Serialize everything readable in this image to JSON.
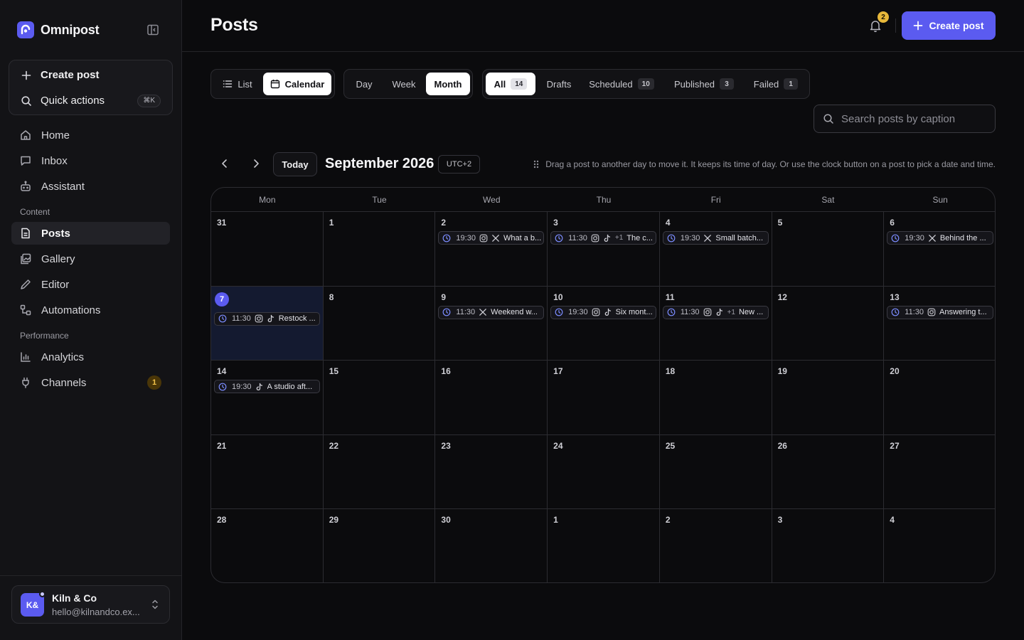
{
  "app": {
    "name": "Omnipost"
  },
  "sidebar": {
    "create_label": "Create post",
    "quick_label": "Quick actions",
    "quick_kbd": "⌘K",
    "main_items": [
      {
        "label": "Home",
        "icon": "home-icon"
      },
      {
        "label": "Inbox",
        "icon": "inbox-icon"
      },
      {
        "label": "Assistant",
        "icon": "bot-icon"
      }
    ],
    "content_label": "Content",
    "content_items": [
      {
        "label": "Posts",
        "icon": "file-icon",
        "active": true
      },
      {
        "label": "Gallery",
        "icon": "gallery-icon"
      },
      {
        "label": "Editor",
        "icon": "pen-icon"
      },
      {
        "label": "Automations",
        "icon": "workflow-icon"
      }
    ],
    "performance_label": "Performance",
    "performance_items": [
      {
        "label": "Analytics",
        "icon": "bar-chart-icon"
      },
      {
        "label": "Channels",
        "icon": "plug-icon",
        "badge": "1"
      }
    ],
    "account": {
      "initials": "K&",
      "name": "Kiln & Co",
      "email": "hello@kilnandco.ex..."
    }
  },
  "header": {
    "title": "Posts",
    "notifications_count": "2",
    "create_label": "Create post"
  },
  "toolbar": {
    "views": [
      {
        "label": "List",
        "active": false
      },
      {
        "label": "Calendar",
        "active": true
      }
    ],
    "ranges": [
      {
        "label": "Day",
        "active": false
      },
      {
        "label": "Week",
        "active": false
      },
      {
        "label": "Month",
        "active": true
      }
    ],
    "filters": [
      {
        "label": "All",
        "count": "14",
        "active": true
      },
      {
        "label": "Drafts",
        "count": "",
        "active": false
      },
      {
        "label": "Scheduled",
        "count": "10",
        "active": false
      },
      {
        "label": "Published",
        "count": "3",
        "active": false
      },
      {
        "label": "Failed",
        "count": "1",
        "active": false
      }
    ],
    "search_placeholder": "Search posts by caption"
  },
  "calendar": {
    "today_label": "Today",
    "month_label": "September 2026",
    "timezone": "UTC+2",
    "hint": "Drag a post to another day to move it. It keeps its time of day. Or use the clock button on a post to pick a date and time.",
    "weekdays": [
      "Mon",
      "Tue",
      "Wed",
      "Thu",
      "Fri",
      "Sat",
      "Sun"
    ],
    "weeks": [
      [
        {
          "day": "31",
          "posts": []
        },
        {
          "day": "1",
          "posts": []
        },
        {
          "day": "2",
          "posts": [
            {
              "time": "19:30",
              "channels": [
                "instagram",
                "x"
              ],
              "extra": "",
              "caption": "What a b..."
            }
          ]
        },
        {
          "day": "3",
          "posts": [
            {
              "time": "11:30",
              "channels": [
                "instagram",
                "tiktok"
              ],
              "extra": "+1",
              "caption": "The c..."
            }
          ]
        },
        {
          "day": "4",
          "posts": [
            {
              "time": "19:30",
              "channels": [
                "x"
              ],
              "extra": "",
              "caption": "Small batch..."
            }
          ]
        },
        {
          "day": "5",
          "posts": []
        },
        {
          "day": "6",
          "posts": [
            {
              "time": "19:30",
              "channels": [
                "x"
              ],
              "extra": "",
              "caption": "Behind the ..."
            }
          ]
        }
      ],
      [
        {
          "day": "7",
          "today": true,
          "posts": [
            {
              "time": "11:30",
              "channels": [
                "instagram",
                "tiktok"
              ],
              "extra": "",
              "caption": "Restock ..."
            }
          ]
        },
        {
          "day": "8",
          "posts": []
        },
        {
          "day": "9",
          "posts": [
            {
              "time": "11:30",
              "channels": [
                "x"
              ],
              "extra": "",
              "caption": "Weekend w..."
            }
          ]
        },
        {
          "day": "10",
          "posts": [
            {
              "time": "19:30",
              "channels": [
                "instagram",
                "tiktok"
              ],
              "extra": "",
              "caption": "Six mont..."
            }
          ]
        },
        {
          "day": "11",
          "posts": [
            {
              "time": "11:30",
              "channels": [
                "instagram",
                "tiktok"
              ],
              "extra": "+1",
              "caption": "New ..."
            }
          ]
        },
        {
          "day": "12",
          "posts": []
        },
        {
          "day": "13",
          "posts": [
            {
              "time": "11:30",
              "channels": [
                "instagram"
              ],
              "extra": "",
              "caption": "Answering t..."
            }
          ]
        }
      ],
      [
        {
          "day": "14",
          "posts": [
            {
              "time": "19:30",
              "channels": [
                "tiktok"
              ],
              "extra": "",
              "caption": "A studio aft..."
            }
          ]
        },
        {
          "day": "15",
          "posts": []
        },
        {
          "day": "16",
          "posts": []
        },
        {
          "day": "17",
          "posts": []
        },
        {
          "day": "18",
          "posts": []
        },
        {
          "day": "19",
          "posts": []
        },
        {
          "day": "20",
          "posts": []
        }
      ],
      [
        {
          "day": "21",
          "posts": []
        },
        {
          "day": "22",
          "posts": []
        },
        {
          "day": "23",
          "posts": []
        },
        {
          "day": "24",
          "posts": []
        },
        {
          "day": "25",
          "posts": []
        },
        {
          "day": "26",
          "posts": []
        },
        {
          "day": "27",
          "posts": []
        }
      ],
      [
        {
          "day": "28",
          "posts": []
        },
        {
          "day": "29",
          "posts": []
        },
        {
          "day": "30",
          "posts": []
        },
        {
          "day": "1",
          "posts": []
        },
        {
          "day": "2",
          "posts": []
        },
        {
          "day": "3",
          "posts": []
        },
        {
          "day": "4",
          "posts": []
        }
      ]
    ]
  },
  "colors": {
    "accent": "#5b5bf0",
    "background": "#0b0b0d",
    "sidebar": "#131316",
    "badge_amber": "#e7b83a"
  }
}
